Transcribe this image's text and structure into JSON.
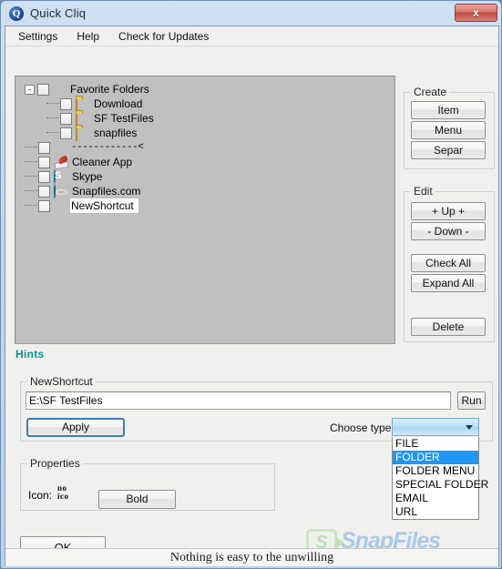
{
  "window": {
    "title": "Quick Cliq",
    "app_icon": "Q",
    "close_label": "x"
  },
  "menubar": {
    "items": [
      {
        "label": "Settings"
      },
      {
        "label": "Help"
      },
      {
        "label": "Check for Updates"
      }
    ]
  },
  "tree": {
    "nodes": [
      {
        "label": "Favorite Folders",
        "icon": "none",
        "depth": 0,
        "expander": "-",
        "checked": false,
        "selected": false
      },
      {
        "label": "Download",
        "icon": "folder",
        "depth": 1,
        "expander": "",
        "checked": false,
        "selected": false
      },
      {
        "label": "SF TestFiles",
        "icon": "folder",
        "depth": 1,
        "expander": "",
        "checked": false,
        "selected": false
      },
      {
        "label": "snapfiles",
        "icon": "folder",
        "depth": 1,
        "expander": "",
        "checked": false,
        "selected": false
      },
      {
        "label": "------------<",
        "icon": "none",
        "depth": 0,
        "expander": "",
        "checked": false,
        "selected": false,
        "separator": true
      },
      {
        "label": "Cleaner App",
        "icon": "cleaner",
        "depth": 0,
        "expander": "",
        "checked": false,
        "selected": false
      },
      {
        "label": "Skype",
        "icon": "skype",
        "depth": 0,
        "expander": "",
        "checked": false,
        "selected": false
      },
      {
        "label": "Snapfiles.com",
        "icon": "globe",
        "depth": 0,
        "expander": "",
        "checked": false,
        "selected": false
      },
      {
        "label": "NewShortcut",
        "icon": "none",
        "depth": 0,
        "expander": "",
        "checked": false,
        "selected": true
      }
    ]
  },
  "create_group": {
    "title": "Create",
    "buttons": [
      {
        "label": "Item"
      },
      {
        "label": "Menu"
      },
      {
        "label": "Separ"
      }
    ]
  },
  "edit_group": {
    "title": "Edit",
    "buttons": [
      {
        "label": "+ Up +"
      },
      {
        "label": "- Down -"
      },
      {
        "label": "Check All"
      },
      {
        "label": "Expand All"
      },
      {
        "label": "Delete"
      }
    ]
  },
  "hints": {
    "label": "Hints"
  },
  "shortcut_group": {
    "title": "NewShortcut",
    "path_value": "E:\\SF TestFiles",
    "path_placeholder": "",
    "run_label": "Run",
    "apply_label": "Apply",
    "choose_type_label": "Choose type",
    "combo_value": "",
    "options": [
      {
        "label": "FILE",
        "selected": false
      },
      {
        "label": "FOLDER",
        "selected": true
      },
      {
        "label": "FOLDER MENU",
        "selected": false
      },
      {
        "label": "SPECIAL FOLDER",
        "selected": false
      },
      {
        "label": "EMAIL",
        "selected": false
      },
      {
        "label": "URL",
        "selected": false
      }
    ]
  },
  "properties": {
    "title": "Properties",
    "icon_label": "Icon:",
    "icon_preview_line1": "no",
    "icon_preview_line2": "ico",
    "bold_label": "Bold"
  },
  "footer": {
    "ok_label": "OK",
    "watermark_logo": "S",
    "watermark_text": "SnapFiles",
    "status_text": "Nothing is easy to the unwilling"
  },
  "colors": {
    "titlebar": "#c3d7ec",
    "close_button": "#c14b40",
    "tree_background": "#c0c0c0",
    "form_background": "#f0f0ef",
    "hints": "#0b9090",
    "combo_accent": "#a8d6f2",
    "dropdown_selection": "#2196f3",
    "focus_border": "#3c7fb1",
    "watermark_green": "#bcdeb4",
    "watermark_blue": "#a8c8e8"
  }
}
